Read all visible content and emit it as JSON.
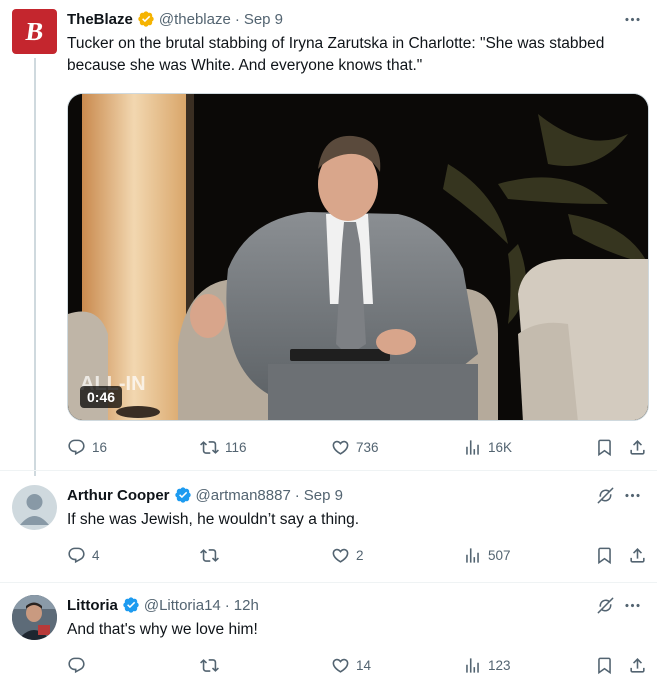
{
  "tweets": [
    {
      "name": "TheBlaze",
      "handle": "@theblaze",
      "date": "Sep 9",
      "verified": "gold",
      "text": "Tucker on the brutal stabbing of Iryna Zarutska in Charlotte: \"She was stabbed because she was White. And everyone knows that.\"",
      "avatar_letter": "B",
      "media": {
        "duration": "0:46",
        "overlay_text": "ALL-IN"
      },
      "stats": {
        "replies": "16",
        "reposts": "116",
        "likes": "736",
        "views": "16K"
      }
    },
    {
      "name": "Arthur Cooper",
      "handle": "@artman8887",
      "date": "Sep 9",
      "verified": "blue",
      "text": "If she was Jewish, he wouldn’t say a thing.",
      "stats": {
        "replies": "4",
        "reposts": "",
        "likes": "2",
        "views": "507"
      }
    },
    {
      "name": "Littoria",
      "handle": "@Littoria14",
      "date": "12h",
      "verified": "blue",
      "text": "And that's why we love him!",
      "stats": {
        "replies": "",
        "reposts": "",
        "likes": "14",
        "views": "123"
      }
    }
  ],
  "ui": {
    "separator_dot": "·"
  },
  "colors": {
    "gold_badge": "#f5b301",
    "blue_badge": "#1d9bf0",
    "brand_red": "#c4262e",
    "muted": "#536471",
    "text": "#0f1419"
  },
  "icons": [
    "more-icon",
    "grok-icon",
    "reply-icon",
    "repost-icon",
    "like-icon",
    "views-icon",
    "bookmark-icon",
    "share-icon",
    "verified-badge-icon"
  ]
}
